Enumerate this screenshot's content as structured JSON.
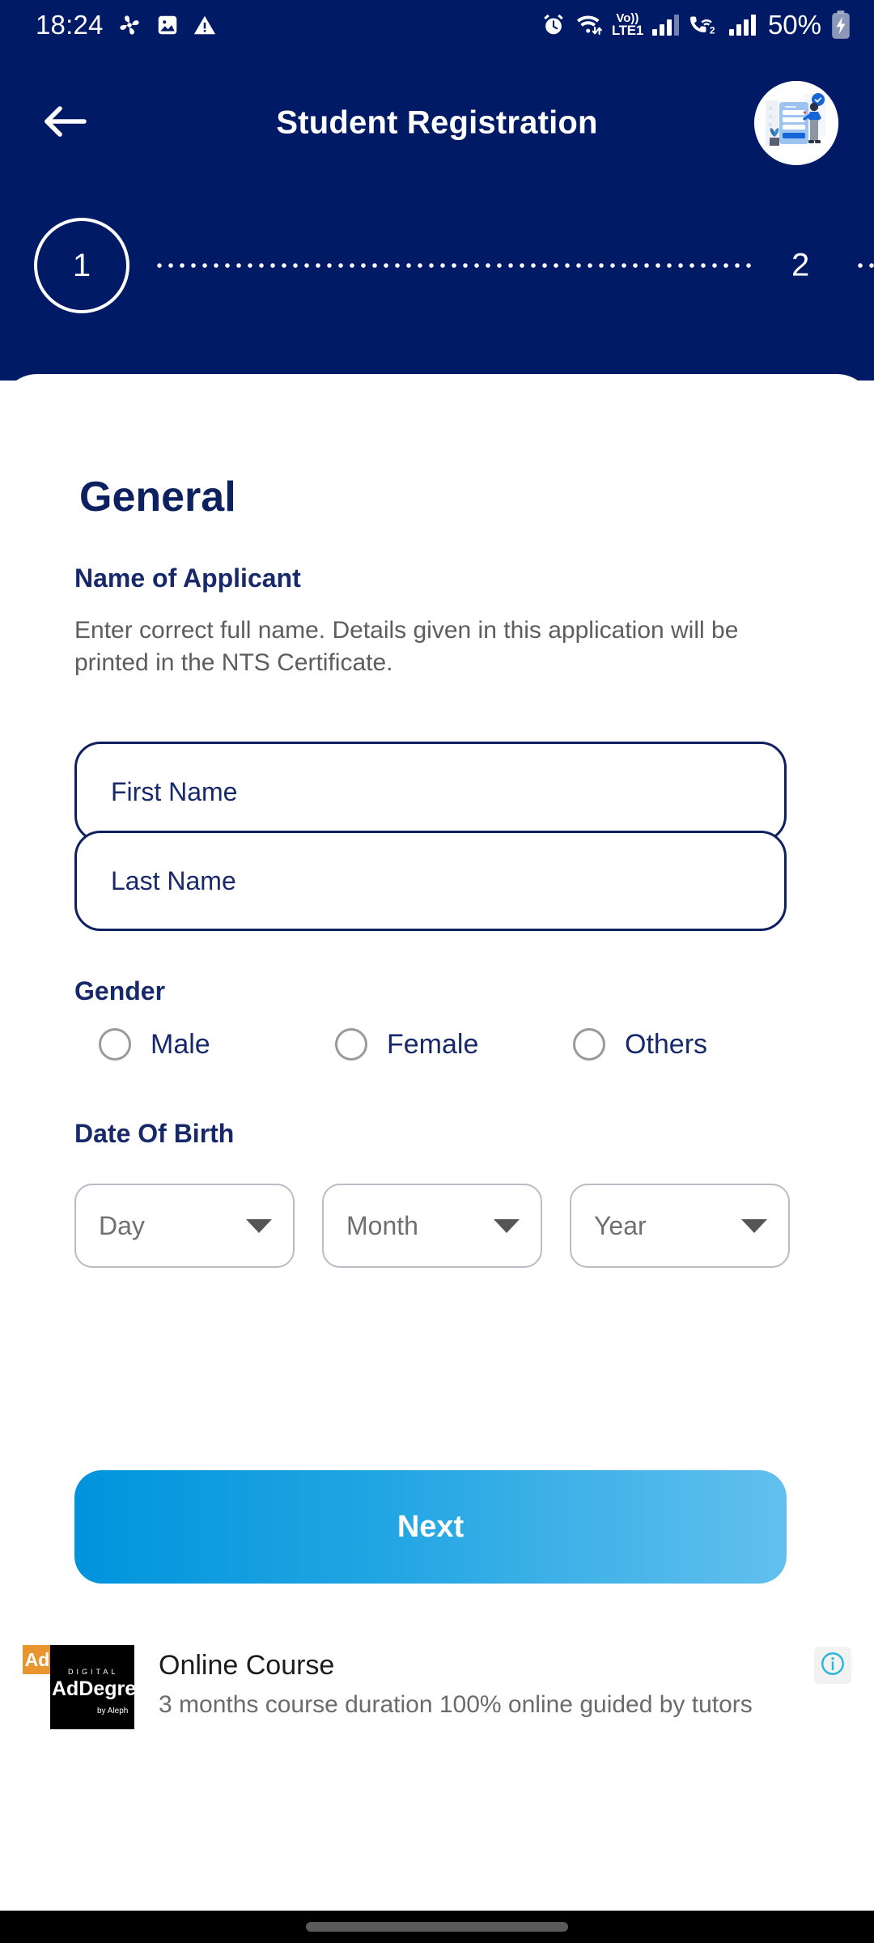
{
  "colors": {
    "navy": "#001a66",
    "heading_navy": "#0d2060",
    "label_navy": "#17296b",
    "help_gray": "#5d5d5d",
    "button_gradient_from": "#0094dd",
    "button_gradient_to": "#62c0ee",
    "ad_badge_orange": "#e8952f",
    "info_icon_cyan": "#29b6d8",
    "radio_border_gray": "#9a9a9a",
    "dropdown_border_gray": "#b9bcc6",
    "nav_bar_black": "#000000",
    "nav_pill_gray": "#5a5a5a"
  },
  "status_bar": {
    "time": "18:24",
    "left_icons": [
      "fan-icon",
      "image-icon",
      "warning-icon"
    ],
    "right_icons": [
      "alarm-icon",
      "wifi-icon",
      "volte-icon",
      "signal-bars-sim1-icon",
      "call-wifi-sim2-icon",
      "signal-bars-sim2-icon",
      "battery-charging-icon"
    ],
    "volte_line1": "Vo))",
    "volte_line2": "LTE1",
    "sim2_label": "2",
    "battery_percent": "50%"
  },
  "app_bar": {
    "back_icon": "arrow-left-icon",
    "title": "Student Registration",
    "avatar_icon": "registration-illustration-avatar"
  },
  "stepper": {
    "steps": [
      {
        "number": "1",
        "active": true
      },
      {
        "number": "2",
        "active": false
      }
    ]
  },
  "form": {
    "section_title": "General",
    "name_group": {
      "label": "Name of Applicant",
      "help": "Enter correct full name. Details given in this application will be printed in the NTS Certificate.",
      "first_name": {
        "value": "",
        "placeholder": "First Name"
      },
      "last_name": {
        "value": "",
        "placeholder": "Last Name"
      }
    },
    "gender_group": {
      "label": "Gender",
      "options": [
        {
          "label": "Male",
          "selected": false
        },
        {
          "label": "Female",
          "selected": false
        },
        {
          "label": "Others",
          "selected": false
        }
      ]
    },
    "dob_group": {
      "label": "Date Of Birth",
      "selects": [
        {
          "name": "day",
          "value": "Day",
          "caret_icon": "chevron-down-icon"
        },
        {
          "name": "month",
          "value": "Month",
          "caret_icon": "chevron-down-icon"
        },
        {
          "name": "year",
          "value": "Year",
          "caret_icon": "chevron-down-icon"
        }
      ]
    },
    "next_button": "Next"
  },
  "ad": {
    "badge": "Ad",
    "logo_line_top": "D I G I T A L",
    "logo_line_main": "AdDegree",
    "logo_line_sub": "by Aleph",
    "title": "Online Course",
    "description": "3 months course duration 100% online guided by tutors",
    "info_icon": "info-icon"
  },
  "nav_bar": {
    "pill_icon": "gesture-pill-handle"
  }
}
